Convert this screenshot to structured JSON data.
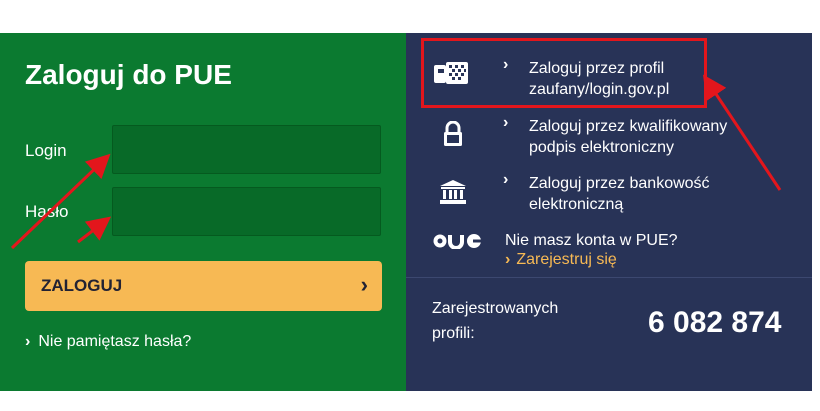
{
  "login_panel": {
    "title": "Zaloguj do PUE",
    "login_label": "Login",
    "password_label": "Hasło",
    "login_value": "",
    "password_value": "",
    "login_button": "ZALOGUJ",
    "forgot_password": "Nie pamiętasz hasła?"
  },
  "options": [
    {
      "icon": "trusted-profile-icon",
      "line1": "Zaloguj przez profil",
      "line2": "zaufany/login.gov.pl"
    },
    {
      "icon": "lock-icon",
      "line1": "Zaloguj przez kwalifikowany",
      "line2": "podpis elektroniczny"
    },
    {
      "icon": "bank-icon",
      "line1": "Zaloguj przez bankowość",
      "line2": "elektroniczną"
    }
  ],
  "no_account": {
    "logo": "PUE",
    "text": "Nie masz konta w PUE?",
    "register_link": "Zarejestruj się"
  },
  "stats": {
    "label": "Zarejestrowanych profili:",
    "value": "6 082 874"
  },
  "colors": {
    "left_panel": "#0b7a30",
    "right_panel": "#283357",
    "button": "#f7b954",
    "annotation": "#e3161c"
  }
}
